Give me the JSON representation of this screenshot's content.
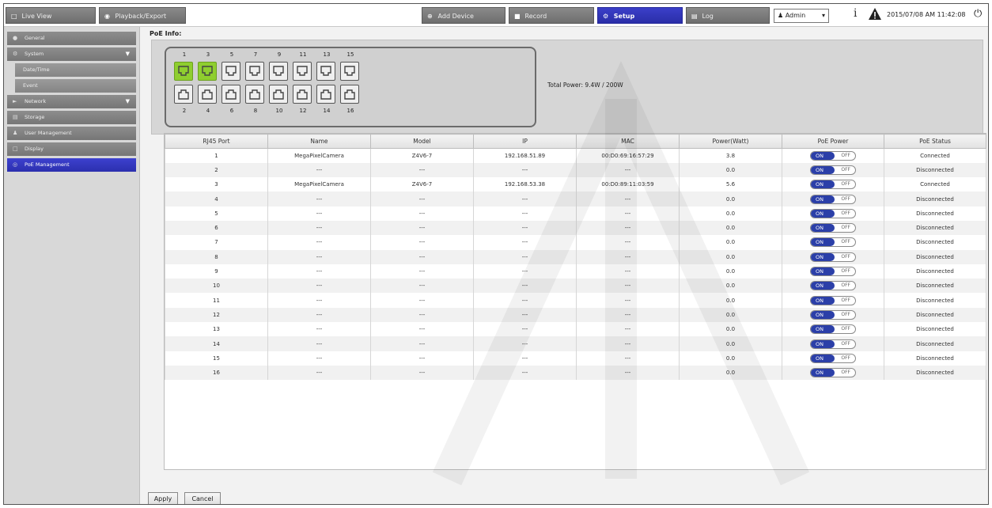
{
  "topbar": {
    "live_view": "Live View",
    "playback": "Playback/Export",
    "add_device": "Add Device",
    "record": "Record",
    "setup": "Setup",
    "log": "Log",
    "user": "Admin",
    "datetime": "2015/07/08 AM 11:42:08"
  },
  "sidebar": {
    "items": [
      {
        "label": "General"
      },
      {
        "label": "System"
      },
      {
        "label": "Date/Time"
      },
      {
        "label": "Event"
      },
      {
        "label": "Network"
      },
      {
        "label": "Storage"
      },
      {
        "label": "User Management"
      },
      {
        "label": "Display"
      },
      {
        "label": "PoE Management"
      }
    ]
  },
  "poe_info": {
    "title": "PoE Info:",
    "top_ports": [
      "1",
      "3",
      "5",
      "7",
      "9",
      "11",
      "13",
      "15"
    ],
    "bottom_ports": [
      "2",
      "4",
      "6",
      "8",
      "10",
      "12",
      "14",
      "16"
    ],
    "total_power": "Total Power: 9.4W / 200W"
  },
  "table": {
    "headers": [
      "RJ45 Port",
      "Name",
      "Model",
      "IP",
      "MAC",
      "Power(Watt)",
      "PoE Power",
      "PoE Status"
    ],
    "toggle_on": "ON",
    "toggle_off": "OFF",
    "rows": [
      {
        "port": "1",
        "name": "MegaPixelCamera",
        "model": "Z4V6-7",
        "ip": "192.168.51.89",
        "mac": "00:D0:69:16:57:29",
        "power": "3.8",
        "status": "Connected"
      },
      {
        "port": "2",
        "name": "---",
        "model": "---",
        "ip": "---",
        "mac": "---",
        "power": "0.0",
        "status": "Disconnected"
      },
      {
        "port": "3",
        "name": "MegaPixelCamera",
        "model": "Z4V6-7",
        "ip": "192.168.53.38",
        "mac": "00:D0:89:11:03:59",
        "power": "5.6",
        "status": "Connected"
      },
      {
        "port": "4",
        "name": "---",
        "model": "---",
        "ip": "---",
        "mac": "---",
        "power": "0.0",
        "status": "Disconnected"
      },
      {
        "port": "5",
        "name": "---",
        "model": "---",
        "ip": "---",
        "mac": "---",
        "power": "0.0",
        "status": "Disconnected"
      },
      {
        "port": "6",
        "name": "---",
        "model": "---",
        "ip": "---",
        "mac": "---",
        "power": "0.0",
        "status": "Disconnected"
      },
      {
        "port": "7",
        "name": "---",
        "model": "---",
        "ip": "---",
        "mac": "---",
        "power": "0.0",
        "status": "Disconnected"
      },
      {
        "port": "8",
        "name": "---",
        "model": "---",
        "ip": "---",
        "mac": "---",
        "power": "0.0",
        "status": "Disconnected"
      },
      {
        "port": "9",
        "name": "---",
        "model": "---",
        "ip": "---",
        "mac": "---",
        "power": "0.0",
        "status": "Disconnected"
      },
      {
        "port": "10",
        "name": "---",
        "model": "---",
        "ip": "---",
        "mac": "---",
        "power": "0.0",
        "status": "Disconnected"
      },
      {
        "port": "11",
        "name": "---",
        "model": "---",
        "ip": "---",
        "mac": "---",
        "power": "0.0",
        "status": "Disconnected"
      },
      {
        "port": "12",
        "name": "---",
        "model": "---",
        "ip": "---",
        "mac": "---",
        "power": "0.0",
        "status": "Disconnected"
      },
      {
        "port": "13",
        "name": "---",
        "model": "---",
        "ip": "---",
        "mac": "---",
        "power": "0.0",
        "status": "Disconnected"
      },
      {
        "port": "14",
        "name": "---",
        "model": "---",
        "ip": "---",
        "mac": "---",
        "power": "0.0",
        "status": "Disconnected"
      },
      {
        "port": "15",
        "name": "---",
        "model": "---",
        "ip": "---",
        "mac": "---",
        "power": "0.0",
        "status": "Disconnected"
      },
      {
        "port": "16",
        "name": "---",
        "model": "---",
        "ip": "---",
        "mac": "---",
        "power": "0.0",
        "status": "Disconnected"
      }
    ]
  },
  "buttons": {
    "apply": "Apply",
    "cancel": "Cancel"
  },
  "colors": {
    "accent": "#2b2fae",
    "port_active": "#8fce2f",
    "toggle_on": "#2b3fa8"
  },
  "icons": {
    "live_view": "monitor-icon",
    "playback": "play-circle-icon",
    "add_device": "plus-circle-icon",
    "record": "record-icon",
    "setup": "gear-icon",
    "log": "document-icon",
    "info": "info-icon",
    "alert": "warning-icon",
    "power": "power-icon"
  }
}
